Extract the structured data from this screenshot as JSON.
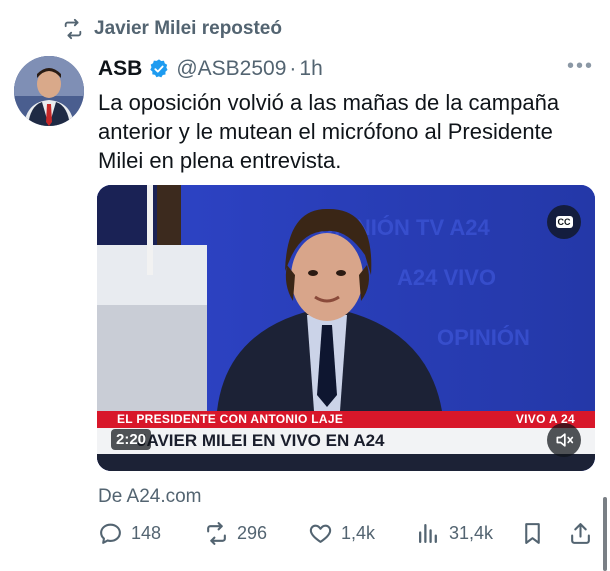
{
  "repost": {
    "label": "Javier Milei reposteó",
    "icon": "repost-icon"
  },
  "tweet": {
    "author_name": "ASB",
    "handle": "@ASB2509",
    "separator": "·",
    "time": "1h",
    "more_icon": "•••",
    "text": "La oposición volvió a las mañas de la campaña anterior y le mutean el micrófono al Presidente Milei en plena entrevista.",
    "verified_color": "#1d9bf0"
  },
  "media": {
    "chyron_top": "EL PRESIDENTE CON ANTONIO LAJE",
    "chyron_live": "VIVO A 24",
    "chyron_main": "JAVIER MILEI EN VIVO EN A24",
    "timer": "2:20",
    "cc_label": "CC"
  },
  "source": "De A24.com",
  "actions": {
    "replies": "148",
    "reposts": "296",
    "likes": "1,4k",
    "views": "31,4k"
  }
}
